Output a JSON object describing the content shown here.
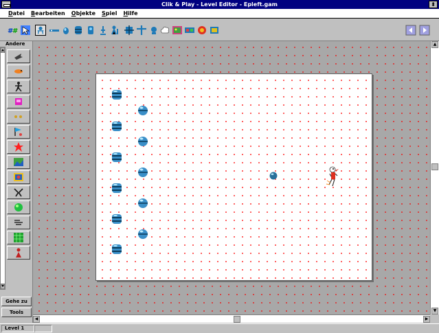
{
  "window": {
    "title": "Clik & Play - Level Editor - Epleft.gam"
  },
  "menu": [
    "Datei",
    "Bearbeiten",
    "Objekte",
    "Spiel",
    "Hilfe"
  ],
  "panel": {
    "header": "Andere",
    "buttons": [
      "Gehe zu",
      "Tools"
    ]
  },
  "status": {
    "level": "Level 1"
  },
  "icons": {
    "toolbar": [
      "view-mode-icon",
      "pointer-icon",
      "spring-character-icon",
      "platform-icon",
      "gem-character-icon",
      "barrel-icon",
      "tank-icon",
      "trophy-icon",
      "person-icon",
      "gear-robot-icon",
      "cross-icon",
      "ball-character-icon",
      "cloud-icon",
      "picture-icon",
      "strip-icon",
      "globe-icon",
      "tile-icon",
      "scroll-left-icon",
      "scroll-right-icon"
    ],
    "sidebar": [
      "arrow-icon",
      "bird-icon",
      "figure-icon",
      "magenta-box-icon",
      "dots-icon",
      "flag-icon",
      "star-icon",
      "picture-icon",
      "painting-icon",
      "puzzle-icon",
      "green-blob-icon",
      "lines-icon",
      "green-grid-icon",
      "red-figure-icon"
    ]
  },
  "colors": {
    "titlebar": "#000080",
    "workspace": "#a8a8a8",
    "level_bg": "#ffffff",
    "grid_dot": "#ff4040",
    "accent": "#1e7ab8"
  }
}
